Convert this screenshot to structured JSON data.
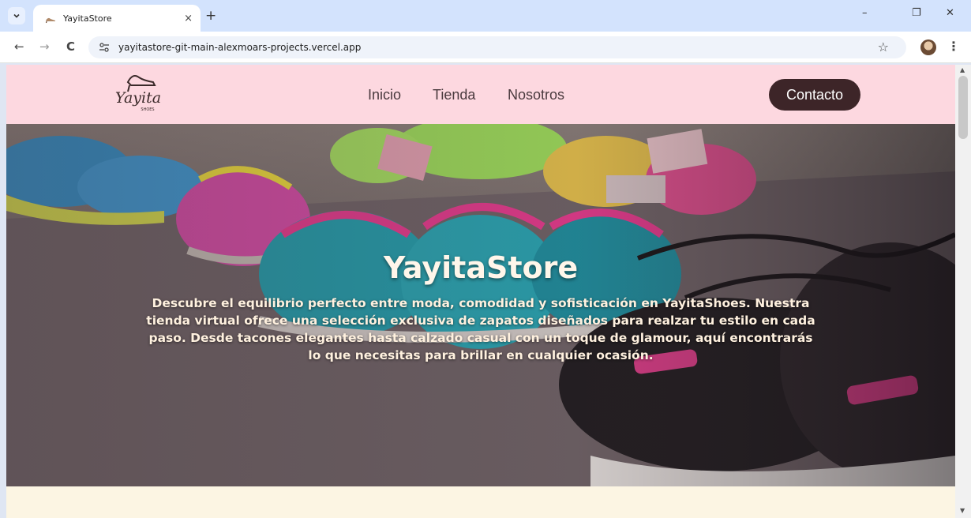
{
  "browser": {
    "tab_title": "YayitaStore",
    "tab_close": "×",
    "new_tab": "+",
    "url": "yayitastore-git-main-alexmoars-projects.vercel.app",
    "window_minimize": "–",
    "window_restore": "❐",
    "window_close": "✕",
    "back": "←",
    "forward": "→",
    "reload": "C",
    "bookmark": "☆",
    "menu": "⋮"
  },
  "site": {
    "logo_text": "Yayita",
    "logo_subtext": "SHOES",
    "nav": [
      {
        "label": "Inicio"
      },
      {
        "label": "Tienda"
      },
      {
        "label": "Nosotros"
      }
    ],
    "cta_label": "Contacto",
    "hero_title": "YayitaStore",
    "hero_description": "Descubre el equilibrio perfecto entre moda, comodidad y sofisticación en YayitaShoes. Nuestra tienda virtual ofrece una selección exclusiva de zapatos diseñados para realzar tu estilo en cada paso. Desde tacones elegantes hasta calzado casual con un toque de glamour, aquí encontrarás lo que necesitas para brillar en cualquier ocasión."
  },
  "colors": {
    "header_bg": "#fdd8e0",
    "cta_bg": "#3d2528",
    "page_bg": "#fcf5e3",
    "browser_tabstrip": "#d3e3fd"
  },
  "icons": {
    "tab_menu": "chevron-down-icon",
    "favicon": "heel-shoe-icon",
    "site_info": "tune-icon",
    "profile": "avatar-icon",
    "scroll_up": "▲",
    "scroll_down": "▼"
  }
}
